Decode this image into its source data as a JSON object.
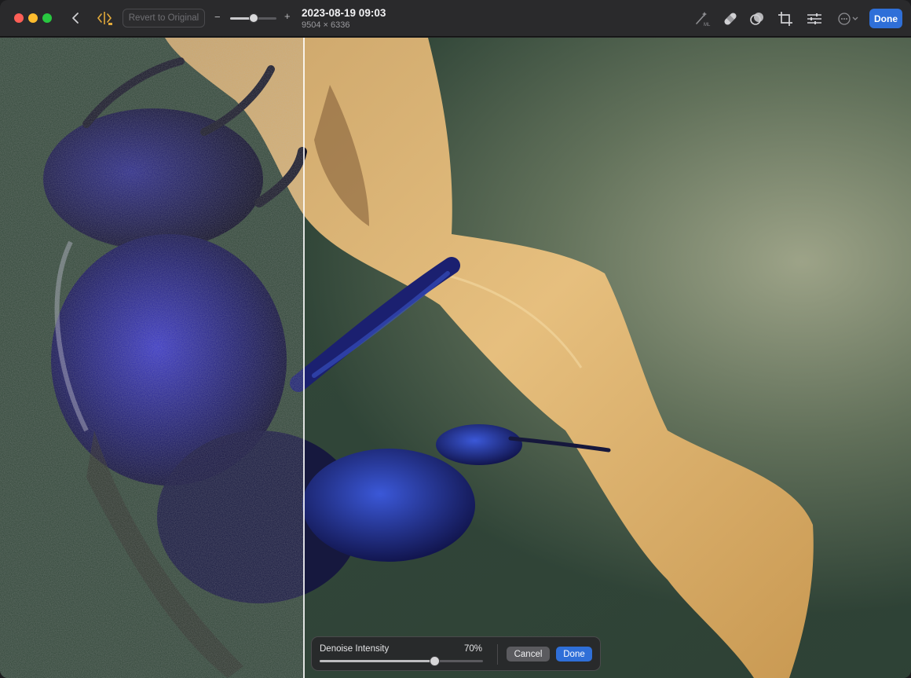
{
  "toolbar": {
    "revert_label": "Revert to Original",
    "zoom_minus": "−",
    "zoom_plus": "+",
    "zoom_level": 0.5,
    "photo_date": "2023-08-19 09:03",
    "photo_dimensions": "9504 × 6336",
    "done_label": "Done",
    "icons": [
      "back-icon",
      "compare-icon",
      "ml-magic-wand-icon",
      "healing-bandage-icon",
      "filter-icon",
      "crop-icon",
      "adjust-sliders-icon",
      "more-ellipsis-icon"
    ]
  },
  "denoise": {
    "label": "Denoise Intensity",
    "value_text": "70%",
    "value": 0.7,
    "cancel_label": "Cancel",
    "done_label": "Done"
  },
  "colors": {
    "accent": "#2f6fd8",
    "close": "#fe5f57",
    "minimize": "#febc2e",
    "maximize": "#28c840"
  }
}
